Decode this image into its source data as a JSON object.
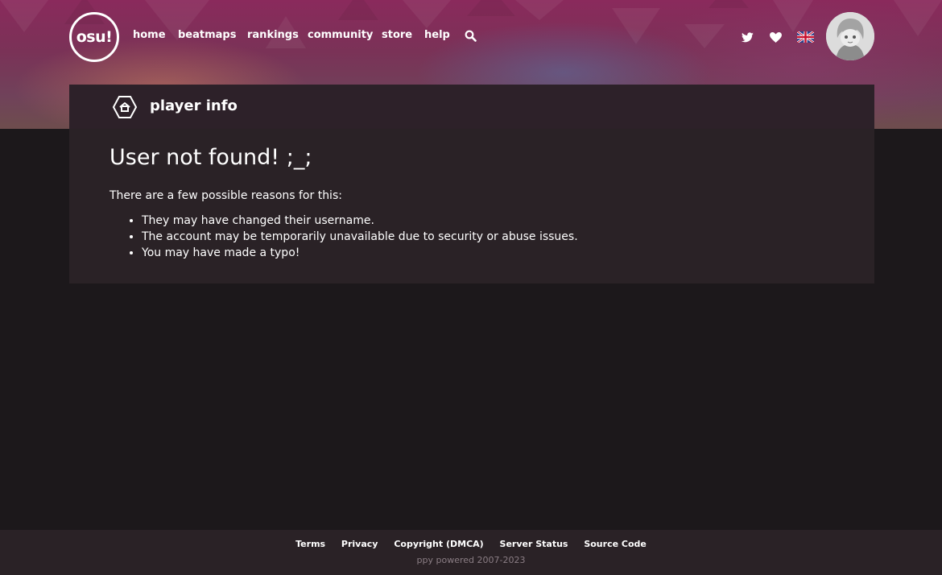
{
  "nav": {
    "logo_text": "osu!",
    "links": [
      "home",
      "beatmaps",
      "rankings",
      "community",
      "store",
      "help"
    ],
    "search_icon": "search-icon",
    "twitter_icon": "twitter-icon",
    "support_icon": "heart-icon",
    "language_icon": "uk-flag-icon"
  },
  "card": {
    "header_icon": "home-hexagon-icon",
    "header_title": "player info",
    "heading": "User not found! ;_;",
    "intro": "There are a few possible reasons for this:",
    "reasons": [
      "They may have changed their username.",
      "The account may be temporarily unavailable due to security or abuse issues.",
      "You may have made a typo!"
    ]
  },
  "footer": {
    "links": [
      "Terms",
      "Privacy",
      "Copyright (DMCA)",
      "Server Status",
      "Source Code"
    ],
    "copyright": "ppy powered 2007-2023"
  },
  "colors": {
    "page_bg": "#1c181b",
    "card_header_bg": "#2d2129",
    "card_body_bg": "#2a2226",
    "footer_bg": "#2a2226",
    "banner_pink": "#8a2a5c"
  }
}
